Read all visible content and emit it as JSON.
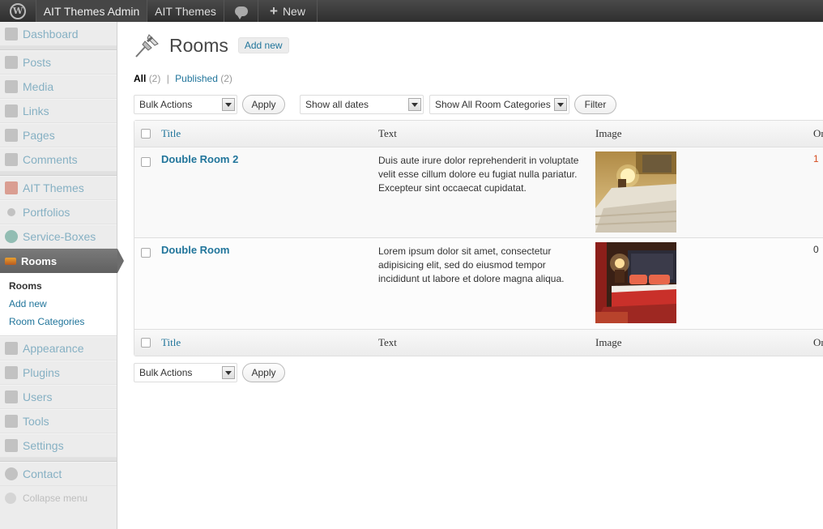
{
  "adminbar": {
    "site_name": "AIT Themes Admin",
    "themes_label": "AIT Themes",
    "new_label": "New"
  },
  "sidebar": {
    "items": [
      {
        "label": "Dashboard"
      },
      {
        "label": "Posts"
      },
      {
        "label": "Media"
      },
      {
        "label": "Links"
      },
      {
        "label": "Pages"
      },
      {
        "label": "Comments"
      },
      {
        "label": "AIT Themes"
      },
      {
        "label": "Portfolios"
      },
      {
        "label": "Service-Boxes"
      },
      {
        "label": "Rooms"
      },
      {
        "label": "Appearance"
      },
      {
        "label": "Plugins"
      },
      {
        "label": "Users"
      },
      {
        "label": "Tools"
      },
      {
        "label": "Settings"
      },
      {
        "label": "Contact"
      }
    ],
    "submenu": [
      "Rooms",
      "Add new",
      "Room Categories"
    ],
    "collapse_label": "Collapse menu"
  },
  "page": {
    "title": "Rooms",
    "add_new": "Add new"
  },
  "filters": {
    "all_label": "All",
    "all_count": "(2)",
    "sep": "|",
    "published_label": "Published",
    "published_count": "(2)"
  },
  "tablenav": {
    "bulk_actions": "Bulk Actions",
    "apply": "Apply",
    "dates": "Show all dates",
    "categories": "Show All Room Categories",
    "filter": "Filter"
  },
  "table": {
    "columns": [
      "Title",
      "Text",
      "Image",
      "Or"
    ],
    "rows": [
      {
        "title": "Double Room 2",
        "text": "Duis aute irure dolor reprehenderit in voluptate velit esse cillum dolore eu fugiat nulla pariatur. Excepteur sint occaecat cupidatat.",
        "order": "1"
      },
      {
        "title": "Double Room",
        "text": "Lorem ipsum dolor sit amet, consectetur adipisicing elit, sed do eiusmod tempor incididunt ut labore et dolore magna aliqua.",
        "order": "0"
      }
    ]
  },
  "colors": {
    "link": "#21759b",
    "order_first": "#d54e21"
  }
}
